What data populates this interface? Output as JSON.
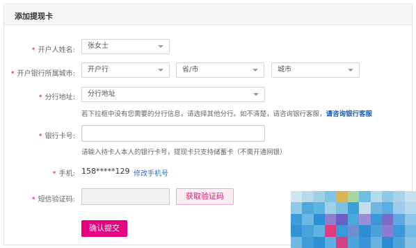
{
  "panel": {
    "title": "添加提现卡"
  },
  "required_mark": "*",
  "account_name": {
    "label": "开户人姓名:",
    "value": "张女士"
  },
  "bank_city": {
    "label": "开户银行所属城市:",
    "bank_placeholder": "开户行",
    "province_placeholder": "省/市",
    "city_placeholder": "城市"
  },
  "branch": {
    "label": "分行地址:",
    "placeholder": "分行地址",
    "hint": "若下拉框中没有您需要的分行信息，请选择其他分行。如不清楚，请咨询银行客服，",
    "hint_link": "请咨询银行客服"
  },
  "card_number": {
    "label": "银行卡号:",
    "value": "",
    "hint": "请输入持卡人本人的银行卡号，提现卡只支持储蓄卡（不需开通网银）"
  },
  "phone": {
    "label": "手机:",
    "value": "158*****129",
    "change_link": "修改手机号"
  },
  "sms_code": {
    "label": "短信验证码:",
    "value": "",
    "get_code_label": "获取验证码"
  },
  "submit_label": "确认提交",
  "colors": {
    "accent": "#e4007f",
    "link": "#2a6fd1"
  },
  "mosaic_colors": [
    "#cfe6f0",
    "#b7dbeb",
    "#9fd0e6",
    "#7ec3e2",
    "#d6b45a",
    "#a9d6a0",
    "#6fbfe3",
    "#b2dcee",
    "#8cc9e4",
    "#a6d2ea",
    "#c6e2f0",
    "#8fc9e6",
    "#4ea8dc",
    "#5fb3df",
    "#9fd0e8",
    "#7ec0e0",
    "#3d9fd8",
    "#c2def0",
    "#6fb7e0",
    "#5aaee0",
    "#9ccce8",
    "#b4d8ee",
    "#3a9cd9",
    "#6db8e2",
    "#2a8fd4",
    "#8a7fd0",
    "#6c5fc8",
    "#4aa8dd",
    "#9a8ed6",
    "#3a97d6",
    "#7b6cc9",
    "#5da8de",
    "#8ec7e8",
    "#2f93d6",
    "#4aa2db",
    "#5db3e0",
    "#e23a7a",
    "#3a9ad8",
    "#6c8fd2",
    "#2e8ed4",
    "#4d9fd9",
    "#8c7bd0",
    "#3c99d7",
    "#74bbe3",
    "#6fb9e2",
    "#3e9dd8",
    "#2f8fd5",
    "#5dafdf",
    "#d13f85",
    "#4aa5db",
    "#3994d6",
    "#66b3e0",
    "#2b8bd3",
    "#4ea4da",
    "#86c3e6"
  ]
}
